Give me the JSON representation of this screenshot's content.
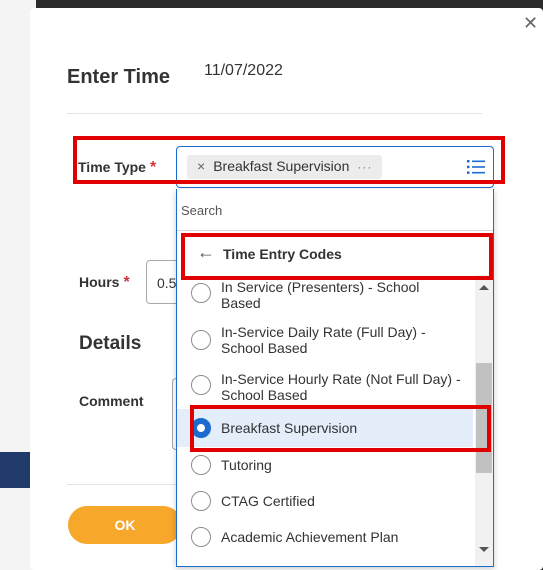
{
  "modal": {
    "title": "Enter Time",
    "date": "11/07/2022",
    "close_icon": "close-icon"
  },
  "form": {
    "time_type_label": "Time Type",
    "required_mark": "*",
    "selected_chip": "Breakfast Supervision",
    "chip_remove": "×",
    "chip_more": "···",
    "hours_label": "Hours",
    "hours_value": "0.5",
    "details_heading": "Details",
    "comment_label": "Comment"
  },
  "dropdown": {
    "search_placeholder": "Search",
    "category_back": "←",
    "category_title": "Time Entry Codes",
    "options": [
      {
        "label": "In Service (Presenters) - School Based",
        "selected": false
      },
      {
        "label": "In-Service Daily Rate (Full Day) - School Based",
        "selected": false
      },
      {
        "label": "In-Service Hourly Rate (Not Full Day) - School Based",
        "selected": false
      },
      {
        "label": "Breakfast Supervision",
        "selected": true
      },
      {
        "label": "Tutoring",
        "selected": false
      },
      {
        "label": "CTAG Certified",
        "selected": false
      },
      {
        "label": "Academic Achievement Plan",
        "selected": false
      }
    ]
  },
  "footer": {
    "ok_label": "OK"
  },
  "colors": {
    "accent_blue": "#1c6cd0",
    "ok_orange": "#f7a72a",
    "required_red": "#d4333a",
    "highlight_red": "#e00000"
  }
}
